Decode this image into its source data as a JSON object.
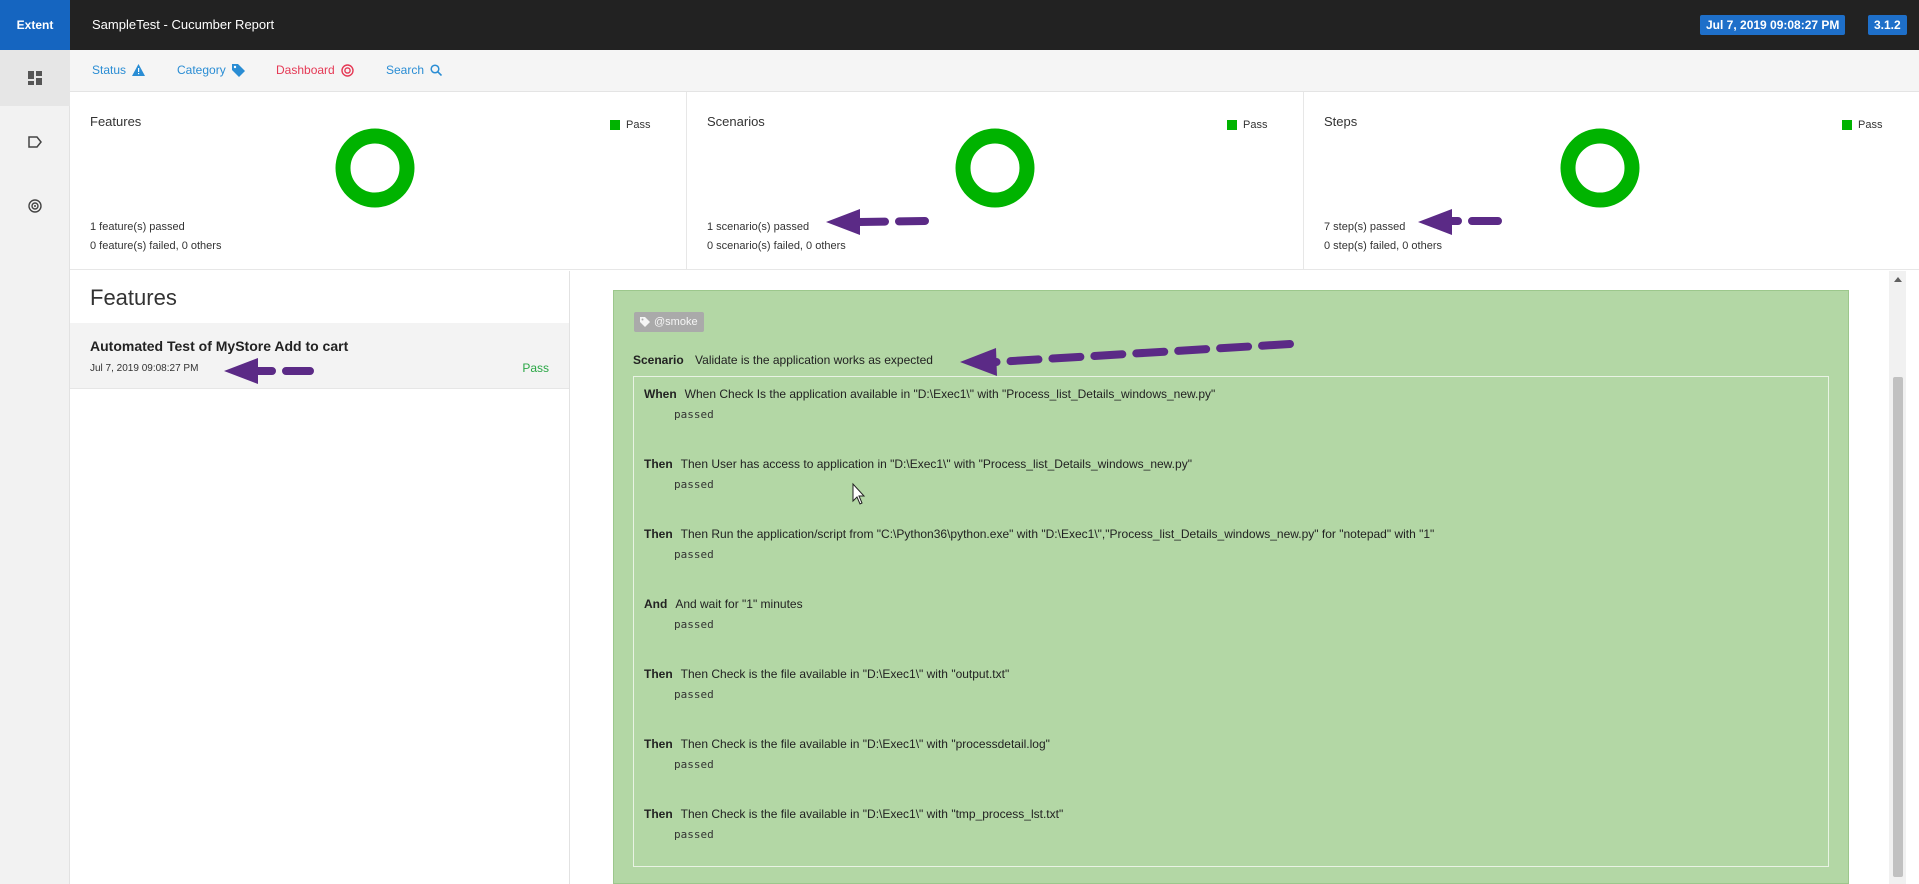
{
  "header": {
    "brand": "Extent",
    "title": "SampleTest - Cucumber Report",
    "date_badge": "Jul 7, 2019 09:08:27 PM",
    "version_badge": "3.1.2"
  },
  "sidenav": {
    "items": [
      {
        "icon": "dashboard-icon"
      },
      {
        "icon": "tag-icon"
      },
      {
        "icon": "target-icon"
      }
    ]
  },
  "subnav": {
    "status": "Status",
    "category": "Category",
    "dashboard": "Dashboard",
    "search": "Search"
  },
  "stats": {
    "features": {
      "title": "Features",
      "legend": "Pass",
      "passed": "1 feature(s) passed",
      "failed": "0 feature(s) failed, 0 others"
    },
    "scenarios": {
      "title": "Scenarios",
      "legend": "Pass",
      "passed": "1 scenario(s) passed",
      "failed": "0 scenario(s) failed, 0 others"
    },
    "steps": {
      "title": "Steps",
      "legend": "Pass",
      "passed": "7 step(s) passed",
      "failed": "0 step(s) failed, 0 others"
    }
  },
  "features_pane": {
    "heading": "Features",
    "items": [
      {
        "name": "Automated Test of MyStore Add to cart",
        "time": "Jul 7, 2019 09:08:27 PM",
        "status": "Pass"
      }
    ]
  },
  "scenario": {
    "tag": "@smoke",
    "keyword": "Scenario",
    "name": "Validate is the application works as expected",
    "steps": [
      {
        "keyword": "When",
        "text": "When Check Is the application available in \"D:\\Exec1\\\" with \"Process_list_Details_windows_new.py\"",
        "status": "passed"
      },
      {
        "keyword": "Then",
        "text": "Then User has access to application in \"D:\\Exec1\\\" with \"Process_list_Details_windows_new.py\"",
        "status": "passed"
      },
      {
        "keyword": "Then",
        "text": "Then Run the application/script from \"C:\\Python36\\python.exe\" with \"D:\\Exec1\\\",\"Process_list_Details_windows_new.py\" for \"notepad\" with \"1\"",
        "status": "passed"
      },
      {
        "keyword": "And",
        "text": "And wait for \"1\" minutes",
        "status": "passed"
      },
      {
        "keyword": "Then",
        "text": "Then Check is the file available in \"D:\\Exec1\\\" with \"output.txt\"",
        "status": "passed"
      },
      {
        "keyword": "Then",
        "text": "Then Check is the file available in \"D:\\Exec1\\\" with \"processdetail.log\"",
        "status": "passed"
      },
      {
        "keyword": "Then",
        "text": "Then Check is the file available in \"D:\\Exec1\\\" with \"tmp_process_lst.txt\"",
        "status": "passed"
      }
    ]
  },
  "colors": {
    "brand": "#1565c0",
    "pass": "#00b300",
    "scenario_bg": "#b3d7a5",
    "annotation": "#5b2a86"
  }
}
